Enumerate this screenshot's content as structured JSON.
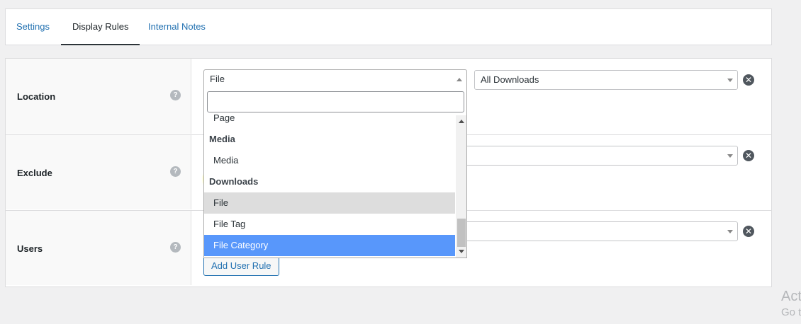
{
  "tabs": [
    {
      "label": "Settings"
    },
    {
      "label": "Display Rules"
    },
    {
      "label": "Internal Notes"
    }
  ],
  "rules": {
    "location": {
      "label": "Location",
      "help": "?",
      "select_value": "File",
      "secondary_value": "All Downloads"
    },
    "exclude": {
      "label": "Exclude",
      "help": "?"
    },
    "users": {
      "label": "Users",
      "help": "?",
      "add_button": "Add User Rule"
    }
  },
  "dropdown": {
    "search_value": "",
    "items": [
      {
        "type": "option",
        "label": "Page"
      },
      {
        "type": "group",
        "label": "Media"
      },
      {
        "type": "option",
        "label": "Media"
      },
      {
        "type": "group",
        "label": "Downloads"
      },
      {
        "type": "option",
        "label": "File",
        "state": "hover"
      },
      {
        "type": "option",
        "label": "File Tag"
      },
      {
        "type": "option",
        "label": "File Category",
        "state": "selected"
      }
    ]
  },
  "icons": {
    "remove": "close-circle-icon",
    "help": "help-icon"
  },
  "colors": {
    "accent": "#2271b1",
    "selected": "#5897fb",
    "highlight": "#fffb3b"
  },
  "watermark": {
    "line1": "Act",
    "line2": "Go t"
  }
}
